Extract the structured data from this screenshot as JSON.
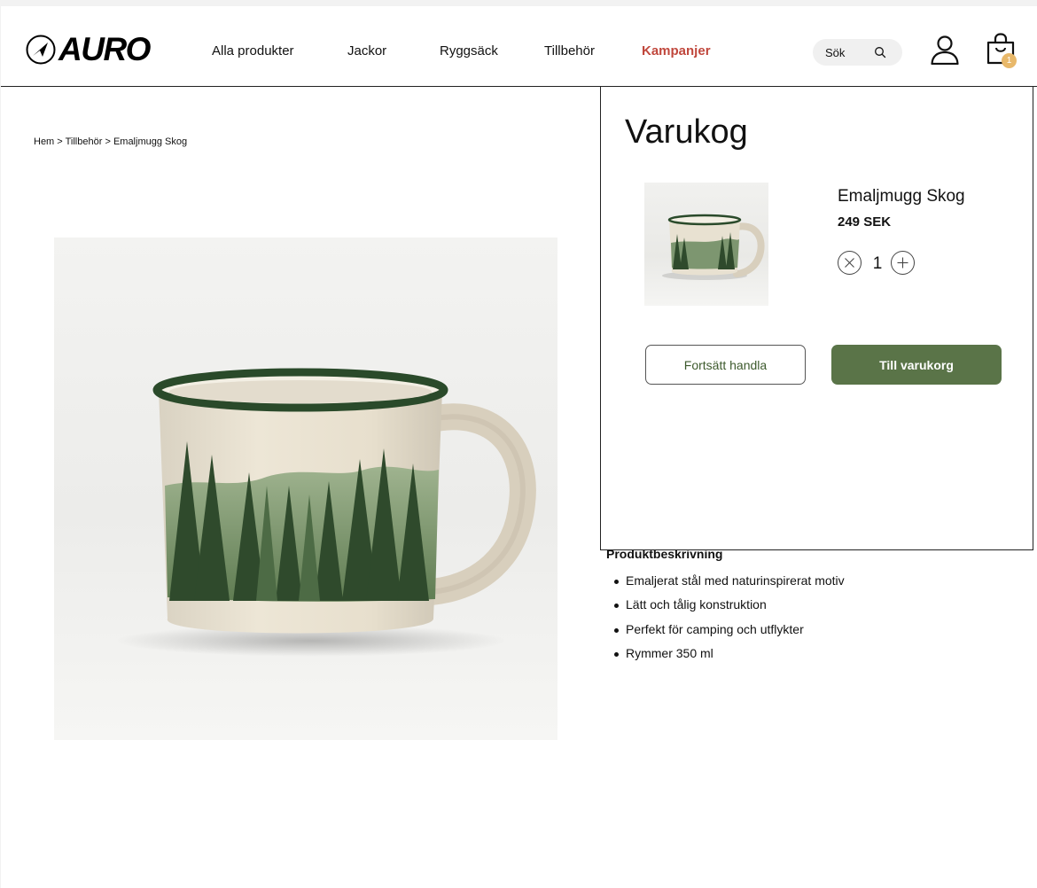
{
  "brand": {
    "name": "AURO"
  },
  "nav": {
    "items": [
      {
        "label": "Alla produkter"
      },
      {
        "label": "Jackor"
      },
      {
        "label": "Ryggsäck"
      },
      {
        "label": "Tillbehör"
      },
      {
        "label": "Kampanjer"
      }
    ]
  },
  "search": {
    "placeholder": "Sök"
  },
  "cart": {
    "count": "1"
  },
  "breadcrumb": {
    "items": [
      "Hem",
      "Tillbehör",
      "Emaljmugg Skog"
    ],
    "separator": ">"
  },
  "product": {
    "description_title": "Produktbeskrivning",
    "description_items": [
      "Emaljerat stål med naturinspirerat motiv",
      "Lätt och tålig konstruktion",
      "Perfekt för camping och utflykter",
      "Rymmer 350 ml"
    ]
  },
  "drawer": {
    "title": "Varukog",
    "item": {
      "name": "Emaljmugg Skog",
      "price": "249 SEK",
      "quantity": "1"
    },
    "continue_label": "Fortsätt handla",
    "checkout_label": "Till varukorg"
  },
  "colors": {
    "accent_green": "#5a7448",
    "promo_red": "#c0473c",
    "badge": "#e8b86a"
  }
}
